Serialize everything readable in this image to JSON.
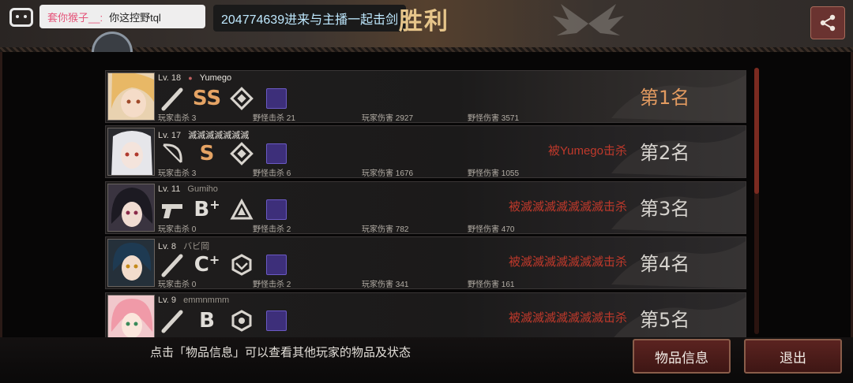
{
  "chat": {
    "user": "套你猴子__:",
    "message": "你这控野tql"
  },
  "danmaku": "204774639进来与主播一起击剑",
  "result_title": "胜利",
  "players": [
    {
      "level": "Lv. 18",
      "name": "Yumego",
      "grade": "SS",
      "grade_mod": "",
      "player_kills": "玩家击杀 3",
      "monster_kills": "野怪击杀 21",
      "player_damage": "玩家伤害 2927",
      "monster_damage": "野怪伤害 3571",
      "killed_by": "",
      "rank": "第1名",
      "weapon_icon": "bat-icon",
      "skill_icon": "diamond-target-icon"
    },
    {
      "level": "Lv. 17",
      "name": "滅滅滅滅滅滅滅",
      "grade": "S",
      "grade_mod": "",
      "player_kills": "玩家击杀 3",
      "monster_kills": "野怪击杀 6",
      "player_damage": "玩家伤害 1676",
      "monster_damage": "野怪伤害 1055",
      "killed_by": "被Yumego击杀",
      "rank": "第2名",
      "weapon_icon": "bow-icon",
      "skill_icon": "diamond-target-icon"
    },
    {
      "level": "Lv. 11",
      "name": "Gumiho",
      "grade": "B",
      "grade_mod": "+",
      "player_kills": "玩家击杀 0",
      "monster_kills": "野怪击杀 2",
      "player_damage": "玩家伤害 782",
      "monster_damage": "野怪伤害 470",
      "killed_by": "被滅滅滅滅滅滅滅击杀",
      "rank": "第3名",
      "weapon_icon": "pistol-icon",
      "skill_icon": "triangle-icon"
    },
    {
      "level": "Lv. 8",
      "name": "バビ岡",
      "grade": "C",
      "grade_mod": "+",
      "player_kills": "玩家击杀 0",
      "monster_kills": "野怪击杀 2",
      "player_damage": "玩家伤害 341",
      "monster_damage": "野怪伤害 161",
      "killed_by": "被滅滅滅滅滅滅滅击杀",
      "rank": "第4名",
      "weapon_icon": "bat-icon",
      "skill_icon": "hexagon-eye-icon"
    },
    {
      "level": "Lv. 9",
      "name": "emmnmmm",
      "grade": "B",
      "grade_mod": "",
      "killed_by": "被滅滅滅滅滅滅滅击杀",
      "rank": "第5名",
      "weapon_icon": "bat-icon",
      "skill_icon": "hexagon-ring-icon"
    }
  ],
  "footer": {
    "hint": "点击「物品信息」可以查看其他玩家的物品及状态",
    "items_button": "物品信息",
    "exit_button": "退出"
  },
  "colors": {
    "accent_red": "#c0392b",
    "rank_gold": "#e29a60",
    "danmaku_blue": "#bfe9ff",
    "chat_pink": "#e5547a"
  }
}
